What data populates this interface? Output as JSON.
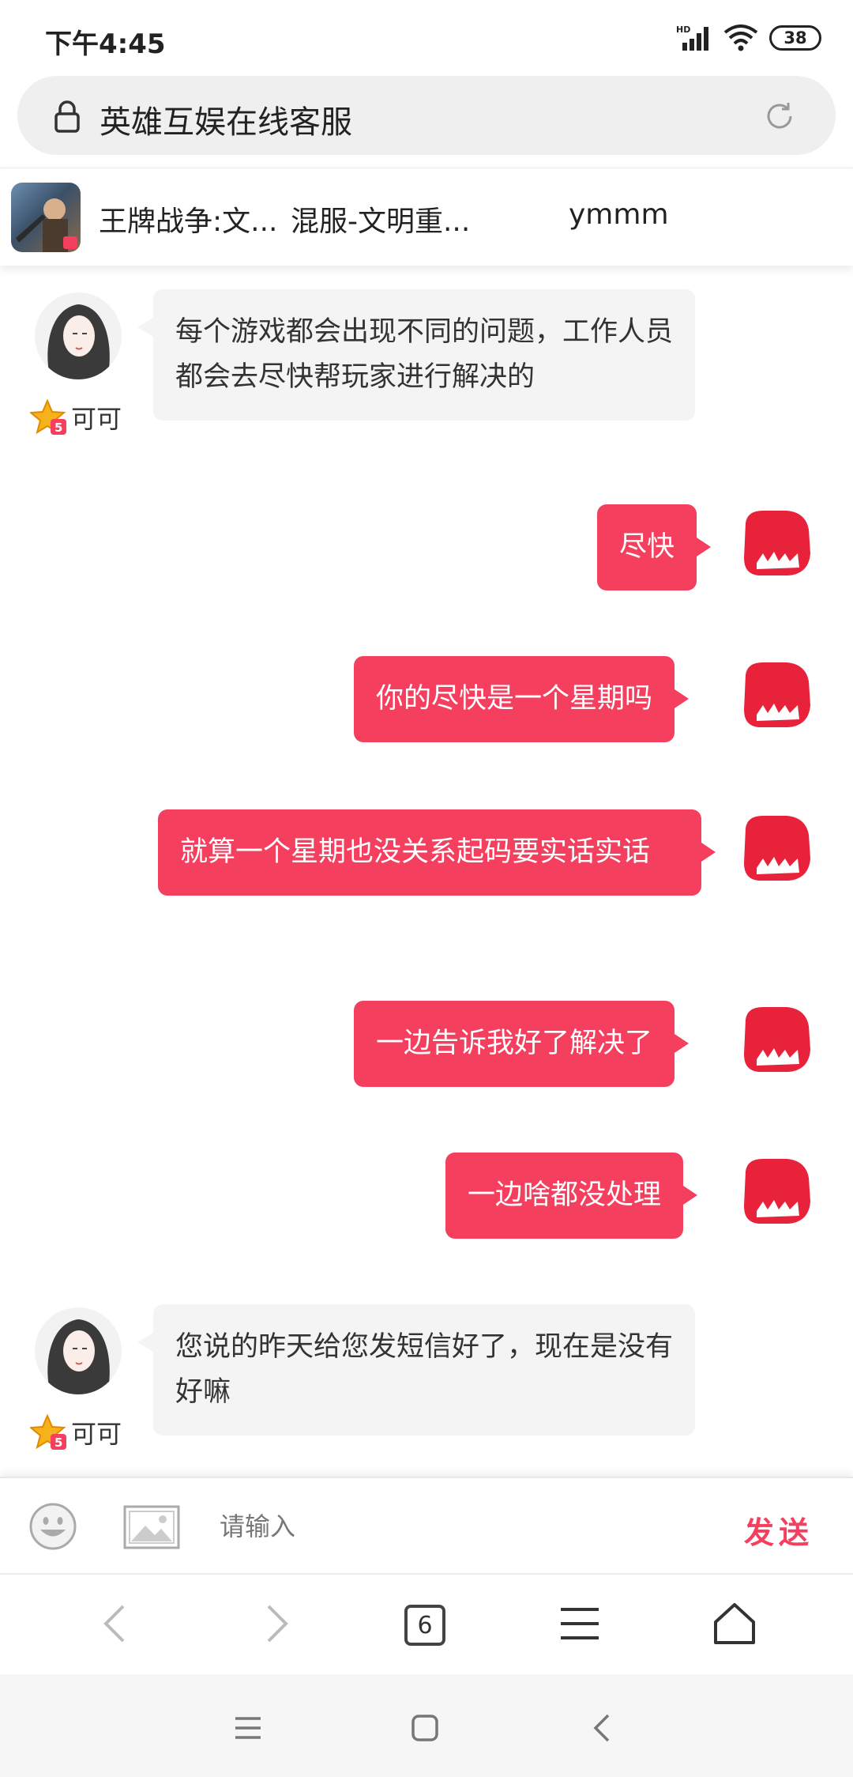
{
  "status_bar": {
    "time": "下午4:45",
    "battery": "38"
  },
  "address_bar": {
    "title": "英雄互娱在线客服"
  },
  "header": {
    "game_name": "王牌战争:文...",
    "server_name": "混服-文明重...",
    "player_name": "ymmm"
  },
  "messages": [
    {
      "from": "agent",
      "name": "可可",
      "text": "每个游戏都会出现不同的问题，工作人员都会去尽快帮玩家进行解决的"
    },
    {
      "from": "user",
      "text": "尽快"
    },
    {
      "from": "user",
      "text": "你的尽快是一个星期吗"
    },
    {
      "from": "user",
      "text": "就算一个星期也没关系起码要实话实话"
    },
    {
      "from": "user",
      "text": "一边告诉我好了解决了"
    },
    {
      "from": "user",
      "text": "一边啥都没处理"
    },
    {
      "from": "agent",
      "name": "可可",
      "text": "您说的昨天给您发短信好了，现在是没有好嘛"
    }
  ],
  "input_bar": {
    "placeholder": "请输入",
    "send_label": "发送"
  },
  "browser_nav": {
    "tab_count": "6"
  },
  "colors": {
    "accent": "#f43f5e",
    "agent_bubble": "#f4f4f4"
  },
  "icons": [
    "lock-icon",
    "refresh-icon",
    "star-badge-icon",
    "emoji-icon",
    "image-icon",
    "back-icon",
    "forward-icon",
    "menu-icon",
    "home-icon"
  ]
}
